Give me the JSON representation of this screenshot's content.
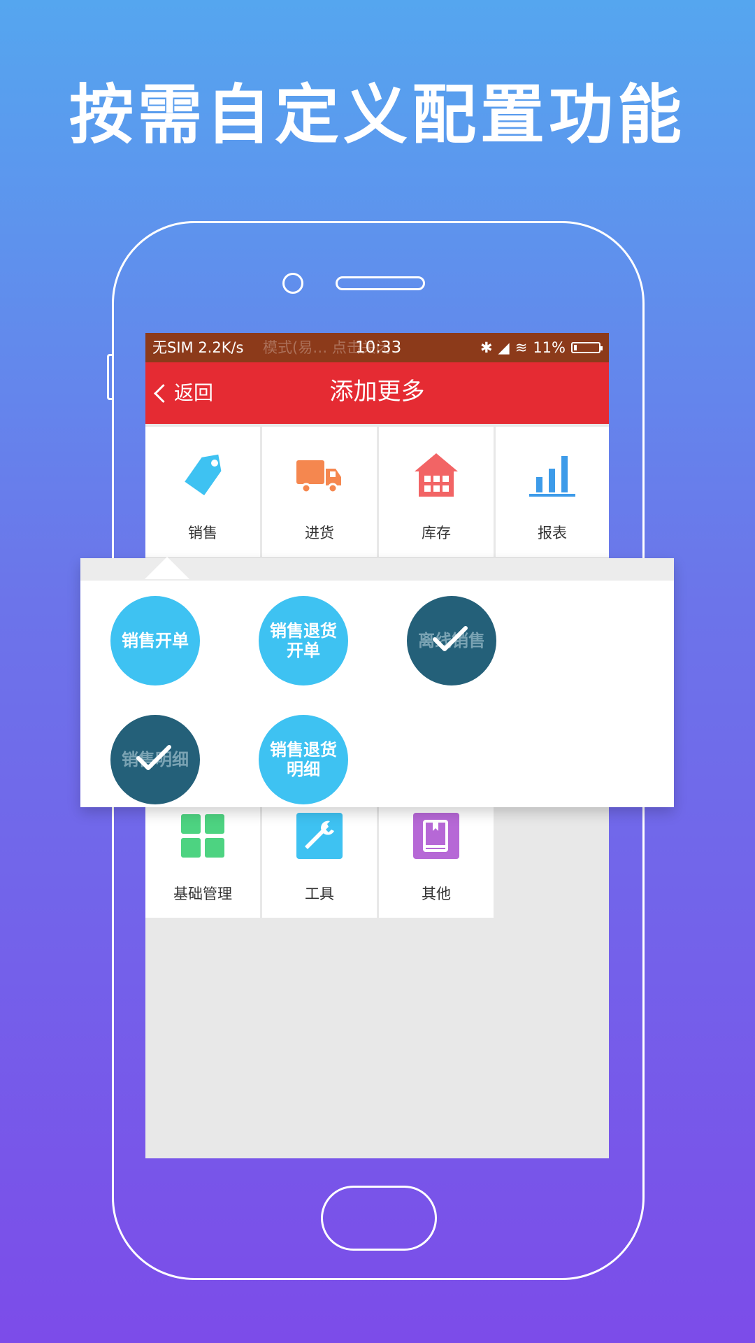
{
  "headline": "按需自定义配置功能",
  "status_bar": {
    "left": "无SIM 2.2K/s",
    "ghost": "模式(易… 点击关闭",
    "time": "10:33",
    "battery": "11%"
  },
  "titlebar": {
    "back_label": "返回",
    "title": "添加更多"
  },
  "grid": [
    {
      "label": "销售",
      "icon": "tag-icon",
      "color": "#3ec2f2"
    },
    {
      "label": "进货",
      "icon": "truck-icon",
      "color": "#f5874f"
    },
    {
      "label": "库存",
      "icon": "warehouse-icon",
      "color": "#f26465"
    },
    {
      "label": "报表",
      "icon": "bar-chart-icon",
      "color": "#3d9be9"
    },
    {
      "label": "基础管理",
      "icon": "grid-icon",
      "color": "#4dd381"
    },
    {
      "label": "工具",
      "icon": "wrench-icon",
      "color": "#3ec2f2"
    },
    {
      "label": "其他",
      "icon": "book-icon",
      "color": "#b668d6"
    }
  ],
  "popup_items": [
    {
      "label": "销售开单",
      "selected": false
    },
    {
      "label": "销售退货开单",
      "selected": false
    },
    {
      "label": "离线销售",
      "selected": true
    },
    {
      "label": "销售明细",
      "selected": true
    },
    {
      "label": "销售退货明细",
      "selected": false
    }
  ],
  "colors": {
    "titlebar": "#e52b33",
    "statusbar": "#8c3a1a",
    "bubble_unselected": "#3ec2f2",
    "bubble_selected": "#246079"
  }
}
